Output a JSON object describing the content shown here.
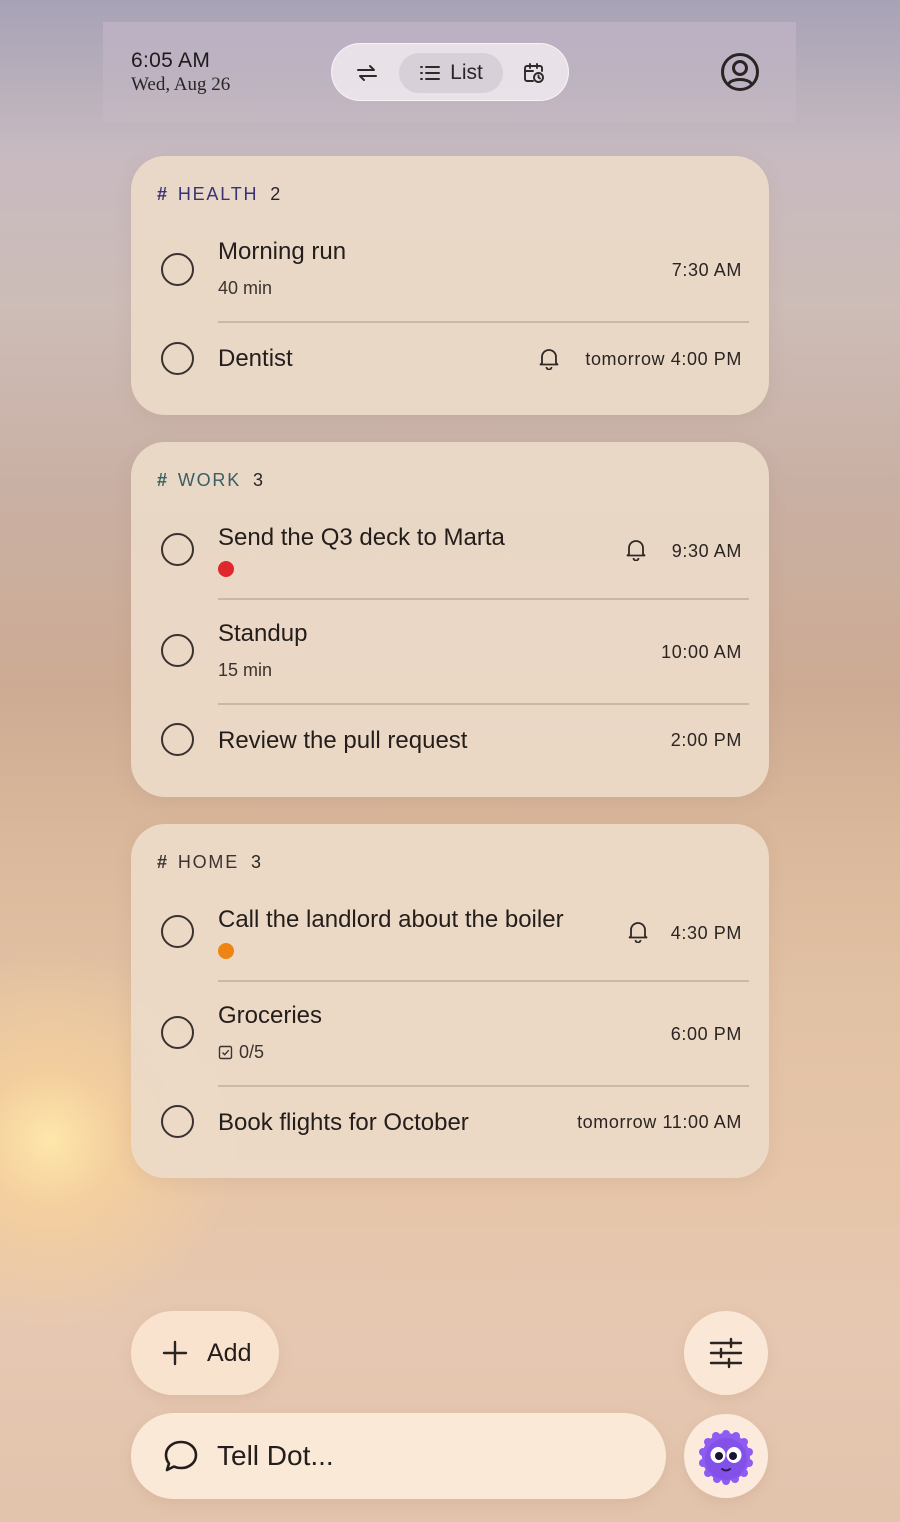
{
  "status": {
    "time": "6:05 AM",
    "date": "Wed, Aug 26"
  },
  "view_switch": {
    "active_label": "List",
    "icons": [
      "repeat-icon",
      "list-icon",
      "calendar-clock-icon"
    ]
  },
  "icons": {
    "profile": "account-circle-icon",
    "bell": "bell-icon",
    "add": "plus-icon",
    "filter": "sliders-icon",
    "chat": "chat-bubble-icon",
    "assistant": "dot-mascot-avatar"
  },
  "groups": [
    {
      "name": "HEALTH",
      "count": "2",
      "color": "#3a3276",
      "tasks": [
        {
          "title": "Morning run",
          "subtitle": "40 min",
          "time": "7:30 AM"
        },
        {
          "title": "Dentist",
          "time": "tomorrow 4:00 PM",
          "reminder": true
        }
      ]
    },
    {
      "name": "WORK",
      "count": "3",
      "color": "#3a5e64",
      "tasks": [
        {
          "title": "Send the Q3 deck to Marta",
          "time": "9:30 AM",
          "reminder": true,
          "priority_color": "#e0272d"
        },
        {
          "title": "Standup",
          "subtitle": "15 min",
          "time": "10:00 AM"
        },
        {
          "title": "Review the pull request",
          "time": "2:00 PM"
        }
      ]
    },
    {
      "name": "HOME",
      "count": "3",
      "color": "#3b3433",
      "tasks": [
        {
          "title": "Call the landlord about the boiler",
          "time": "4:30 PM",
          "reminder": true,
          "priority_color": "#ee8414"
        },
        {
          "title": "Groceries",
          "subtitle": "0/5",
          "time": "6:00 PM"
        },
        {
          "title": "Book flights for October",
          "time": "tomorrow 11:00 AM"
        }
      ]
    }
  ],
  "actions": {
    "add_label": "Add"
  },
  "assistant": {
    "placeholder": "Tell Dot..."
  }
}
